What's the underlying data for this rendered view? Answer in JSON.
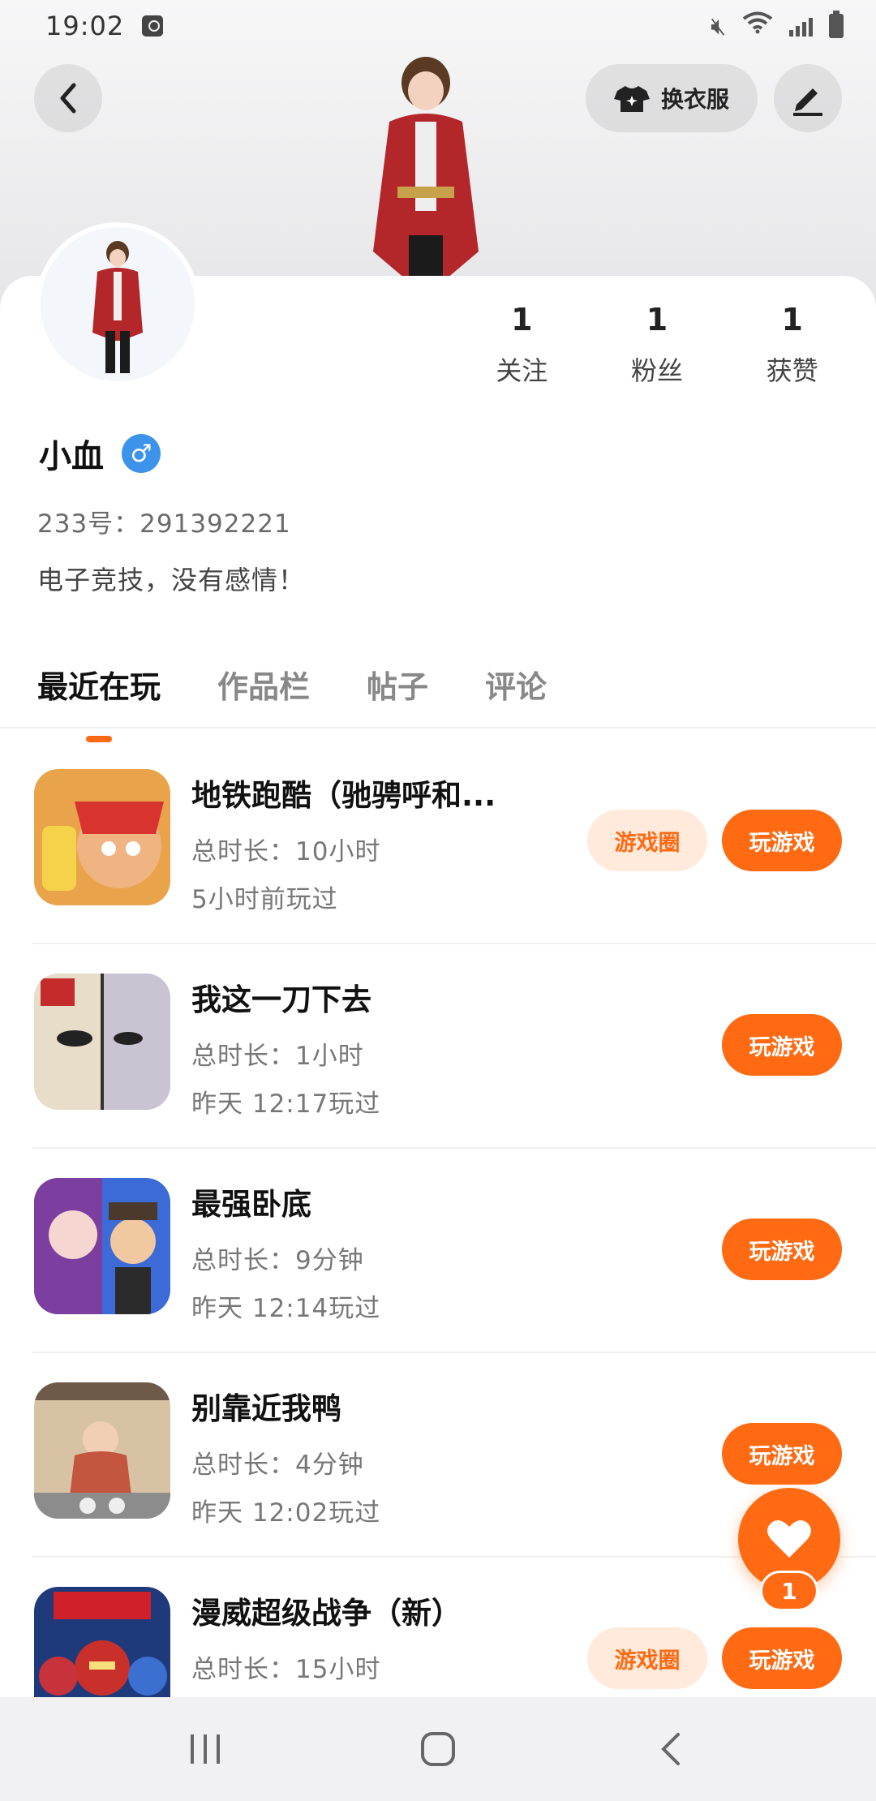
{
  "status_bar": {
    "time": "19:02"
  },
  "header": {
    "dress_label": "换衣服"
  },
  "profile": {
    "stats": [
      {
        "value": "1",
        "label": "关注"
      },
      {
        "value": "1",
        "label": "粉丝"
      },
      {
        "value": "1",
        "label": "获赞"
      }
    ],
    "name": "小血",
    "gender_symbol": "♂",
    "uid": "233号：291392221",
    "bio": "电子竞技，没有感情！"
  },
  "tabs": [
    {
      "label": "最近在玩",
      "active": true
    },
    {
      "label": "作品栏",
      "active": false
    },
    {
      "label": "帖子",
      "active": false
    },
    {
      "label": "评论",
      "active": false
    }
  ],
  "games": [
    {
      "title": "地铁跑酷（驰骋呼和...",
      "duration": "总时长：10小时",
      "last_played": "5小时前玩过",
      "circle_label": "游戏圈",
      "play_label": "玩游戏"
    },
    {
      "title": "我这一刀下去",
      "duration": "总时长：1小时",
      "last_played": "昨天 12:17玩过",
      "play_label": "玩游戏"
    },
    {
      "title": "最强卧底",
      "duration": "总时长：9分钟",
      "last_played": "昨天 12:14玩过",
      "play_label": "玩游戏"
    },
    {
      "title": "别靠近我鸭",
      "duration": "总时长：4分钟",
      "last_played": "昨天 12:02玩过",
      "play_label": "玩游戏"
    },
    {
      "title": "漫威超级战争（新）",
      "duration": "总时长：15小时",
      "last_played": "",
      "circle_label": "游戏圈",
      "play_label": "玩游戏"
    }
  ],
  "like": {
    "count": "1"
  },
  "colors": {
    "accent": "#ff6a13",
    "accent_light": "#ffeadc",
    "gender_blue": "#3d93ea"
  }
}
